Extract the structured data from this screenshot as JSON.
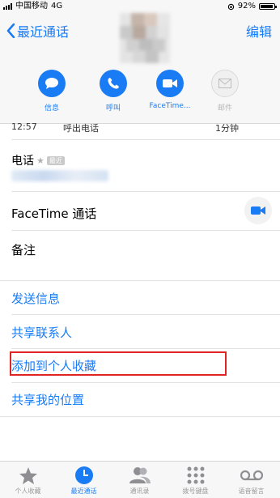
{
  "status_bar": {
    "carrier": "中国移动",
    "network": "4G",
    "time": "",
    "battery": "92%"
  },
  "header": {
    "back_label": "最近通话",
    "edit_label": "编辑"
  },
  "actions": [
    {
      "label": "信息",
      "icon": "message-icon"
    },
    {
      "label": "呼叫",
      "icon": "phone-icon"
    },
    {
      "label": "FaceTime...",
      "icon": "video-icon"
    },
    {
      "label": "邮件",
      "icon": "mail-icon"
    }
  ],
  "call_entry": {
    "time": "12:57",
    "type": "呼出电话",
    "duration": "1分钟"
  },
  "phone": {
    "label": "电话",
    "badge": "最近"
  },
  "facetime": {
    "label": "FaceTime 通话"
  },
  "notes": {
    "label": "备注"
  },
  "links": {
    "send_message": "发送信息",
    "share_contact": "共享联系人",
    "add_favorite": "添加到个人收藏",
    "share_location": "共享我的位置"
  },
  "tabs": [
    {
      "label": "个人收藏",
      "icon": "star-icon"
    },
    {
      "label": "最近通话",
      "icon": "clock-icon"
    },
    {
      "label": "通讯录",
      "icon": "contacts-icon"
    },
    {
      "label": "拨号键盘",
      "icon": "keypad-icon"
    },
    {
      "label": "语音留言",
      "icon": "voicemail-icon"
    }
  ],
  "colors": {
    "accent": "#1a7cf5",
    "highlight": "#e02424"
  }
}
